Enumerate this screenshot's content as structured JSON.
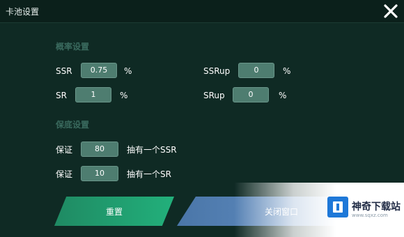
{
  "window": {
    "title": "卡池设置",
    "close_icon": "close-icon"
  },
  "sections": {
    "probability_title": "概率设置",
    "guarantee_title": "保底设置"
  },
  "probability": {
    "ssr_label": "SSR",
    "ssr_value": "0.75",
    "ssr_unit": "%",
    "ssrup_label": "SSRup",
    "ssrup_value": "0",
    "ssrup_unit": "%",
    "sr_label": "SR",
    "sr_value": "1",
    "sr_unit": "%",
    "srup_label": "SRup",
    "srup_value": "0",
    "srup_unit": "%"
  },
  "guarantee": {
    "row1_prefix": "保证",
    "row1_value": "80",
    "row1_suffix": "抽有一个SSR",
    "row2_prefix": "保证",
    "row2_value": "10",
    "row2_suffix": "抽有一个SR"
  },
  "buttons": {
    "reset_label": "重置",
    "close_label": "关闭窗口"
  },
  "watermark": {
    "text": "神奇下载站",
    "url": "www.sqxz.com"
  },
  "colors": {
    "background": "#0f2a24",
    "field": "#4e7d70",
    "reset_button": "#22b07b",
    "close_button": "#5d89bd"
  }
}
